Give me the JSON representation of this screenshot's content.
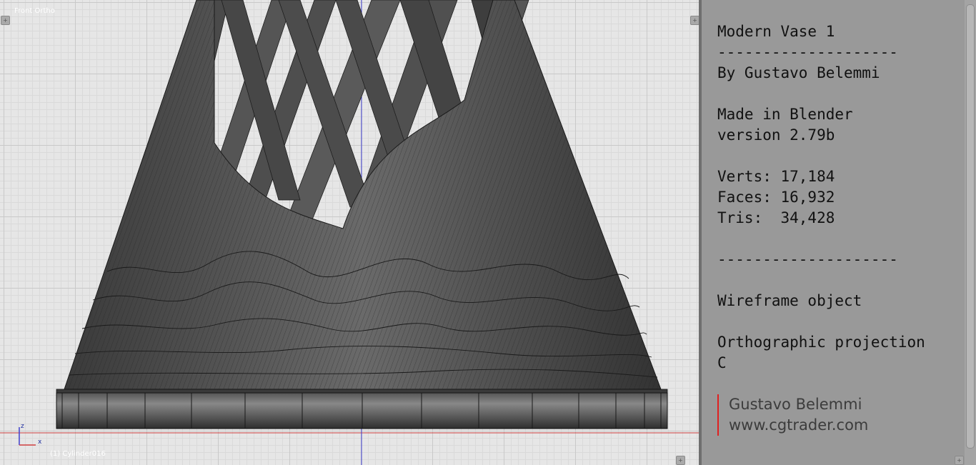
{
  "viewport": {
    "view_name": "Front Ortho",
    "object_name": "(1) Cylinder016",
    "axis_labels": {
      "z": "z",
      "x": "x"
    }
  },
  "text_editor": {
    "lines": [
      "Modern Vase 1",
      "--------------------",
      "By Gustavo Belemmi",
      "",
      "Made in Blender",
      "version 2.79b",
      "",
      "Verts: 17,184",
      "Faces: 16,932",
      "Tris:  34,428",
      "",
      "--------------------",
      "",
      "Wireframe object",
      "",
      "Orthographic projection",
      "C"
    ],
    "watermark": {
      "author": "Gustavo Belemmi",
      "site": "www.cgtrader.com"
    }
  },
  "colors": {
    "viewport_bg": "#e6e6e6",
    "model": "#4a4a4a",
    "x_axis": "#d04040",
    "z_axis": "#4040d0",
    "panel_bg": "#999999",
    "watermark_bar": "#e02020"
  }
}
